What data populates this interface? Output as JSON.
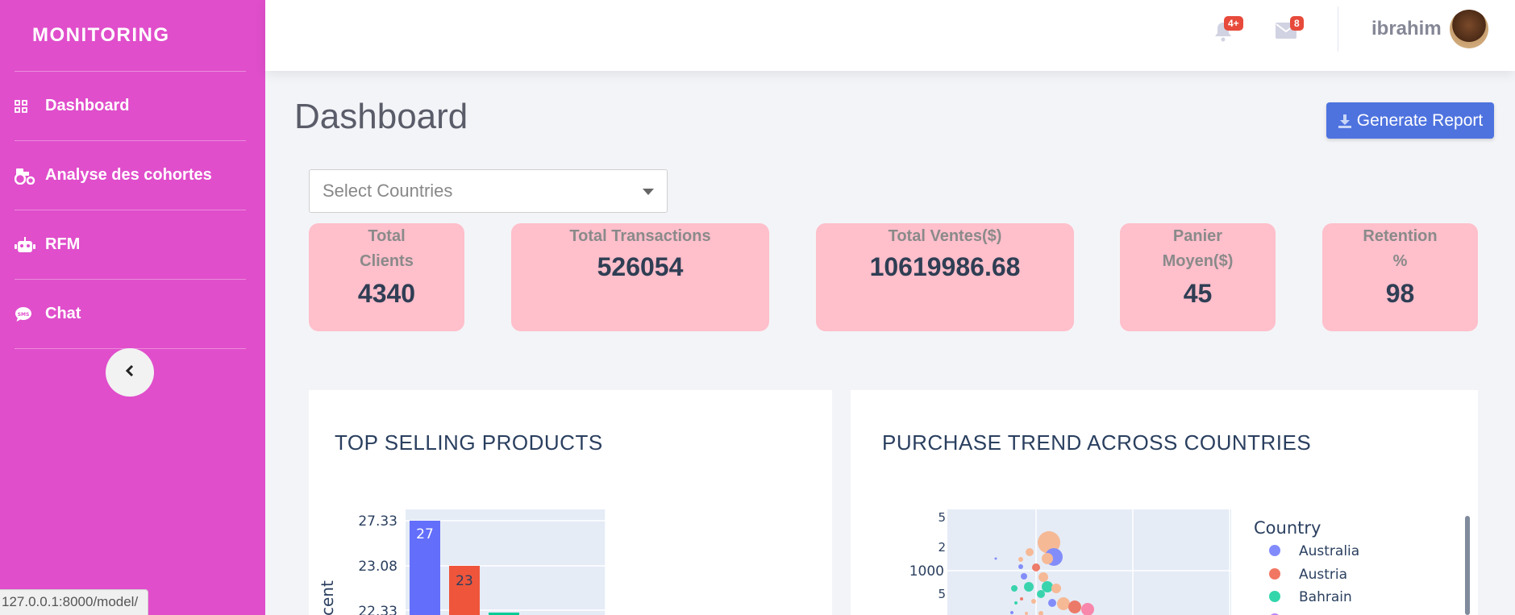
{
  "sidebar": {
    "brand": "MONITORING",
    "items": [
      {
        "label": "Dashboard",
        "icon": "grid-icon"
      },
      {
        "label": "Analyse des cohortes",
        "icon": "tractor-icon"
      },
      {
        "label": "RFM",
        "icon": "robot-icon"
      },
      {
        "label": "Chat",
        "icon": "sms-icon"
      }
    ],
    "toggle_icon": "chevron-left-icon",
    "color": "#e04ecb"
  },
  "topbar": {
    "alerts_badge": "4+",
    "messages_badge": "8",
    "username": "ibrahim"
  },
  "page": {
    "title": "Dashboard",
    "report_button": "Generate Report"
  },
  "filter": {
    "placeholder": "Select Countries"
  },
  "kpis": [
    {
      "label_line1": "Total",
      "label_line2": "Clients",
      "value": "4340"
    },
    {
      "label_line1": "Total Transactions",
      "label_line2": "",
      "value": "526054"
    },
    {
      "label_line1": "Total Ventes($)",
      "label_line2": "",
      "value": "10619986.68"
    },
    {
      "label_line1": "Panier",
      "label_line2": "Moyen($)",
      "value": "45"
    },
    {
      "label_line1": "Retention",
      "label_line2": "%",
      "value": "98"
    }
  ],
  "charts": {
    "top_products": {
      "title": "TOP SELLING PRODUCTS",
      "ylabel_visible": "cent",
      "ytick_labels": [
        "27.33",
        "23.08",
        "22.33"
      ],
      "bars": [
        {
          "value": 27,
          "label": "27",
          "color": "#636efa"
        },
        {
          "value": 23,
          "label": "23",
          "color": "#ef553b"
        },
        {
          "value": 22.5,
          "label": "",
          "color": "#00cc96"
        }
      ]
    },
    "purchase_trend": {
      "title": "PURCHASE TREND ACROSS COUNTRIES",
      "ytick_labels": [
        "5",
        "2",
        "1000",
        "5"
      ],
      "legend_title": "Country",
      "legend": [
        {
          "name": "Australia",
          "color": "#636efa"
        },
        {
          "name": "Austria",
          "color": "#ef553b"
        },
        {
          "name": "Bahrain",
          "color": "#00cc96"
        }
      ]
    }
  },
  "status_bar": {
    "url": "127.0.0.1:8000/model/"
  }
}
